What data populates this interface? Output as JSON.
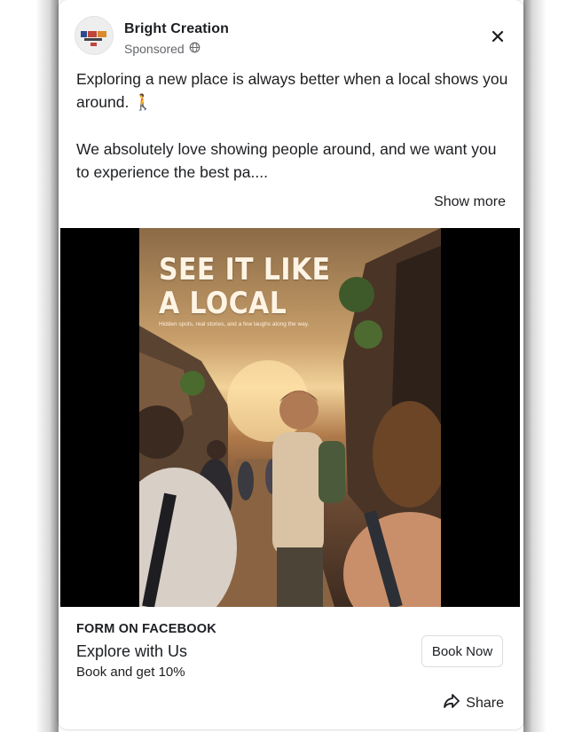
{
  "post": {
    "page_name": "Bright Creation",
    "sponsored_label": "Sponsored",
    "body_paragraphs": [
      "Exploring a new place is always better when a local shows you around. 🚶",
      "We absolutely love showing people around, and we want you to experience the best pa...."
    ],
    "show_more_label": "Show more"
  },
  "creative": {
    "headline": "SEE IT LIKE\nA LOCAL",
    "subhead": "Hidden spots, real stories, and a few laughs along the way."
  },
  "footer": {
    "form_label": "FORM ON FACEBOOK",
    "title": "Explore with Us",
    "description": "Book and get 10%",
    "cta_label": "Book Now",
    "share_label": "Share"
  },
  "icons": {
    "close": "close-icon",
    "globe": "globe-icon",
    "share": "share-icon"
  },
  "colors": {
    "text_primary": "#1c1e21",
    "text_secondary": "#65676b",
    "border": "#dadde1"
  }
}
